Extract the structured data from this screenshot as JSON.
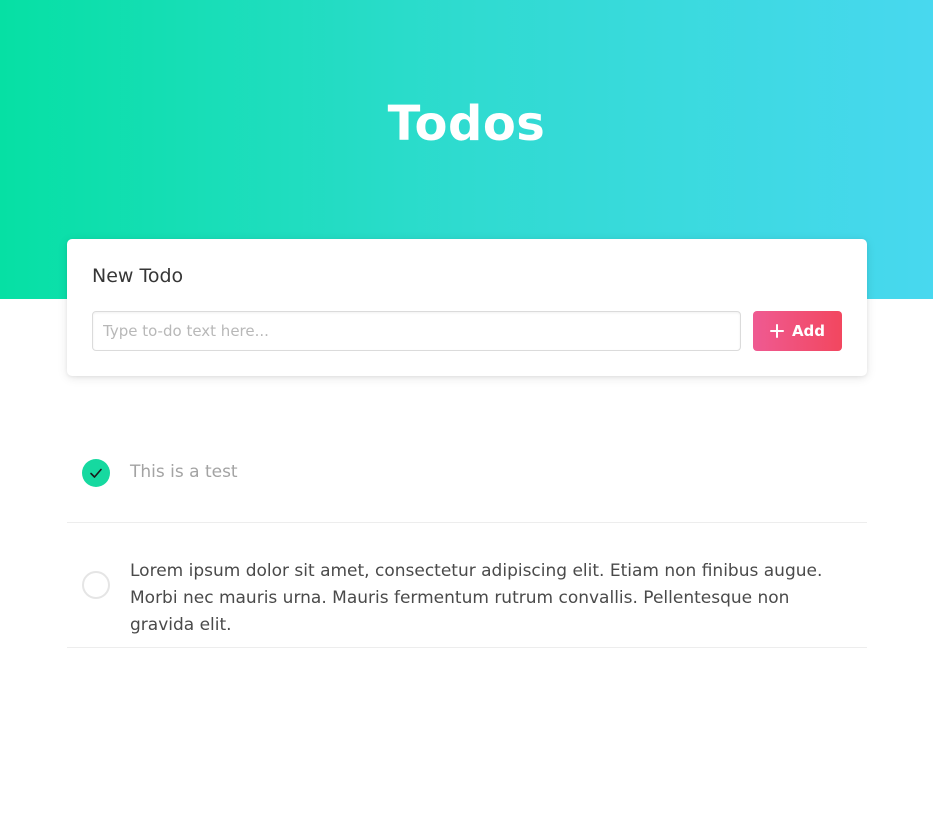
{
  "header": {
    "title": "Todos"
  },
  "new_todo": {
    "heading": "New Todo",
    "input": {
      "placeholder": "Type to-do text here...",
      "value": ""
    },
    "add_button_label": "Add",
    "add_icon": "plus-icon"
  },
  "todos": [
    {
      "text": "This is a test",
      "completed": true,
      "check_icon": "check-icon"
    },
    {
      "text": "Lorem ipsum dolor sit amet, consectetur adipiscing elit. Etiam non finibus augue. Morbi nec mauris urna. Mauris fermentum rutrum convallis. Pellentesque non gravida elit.",
      "completed": false
    }
  ],
  "colors": {
    "header_gradient_start": "#06e0a4",
    "header_gradient_end": "#48d8ef",
    "add_button_start": "#ef5a92",
    "add_button_end": "#f2475f",
    "completed_check": "#16d9a0"
  }
}
